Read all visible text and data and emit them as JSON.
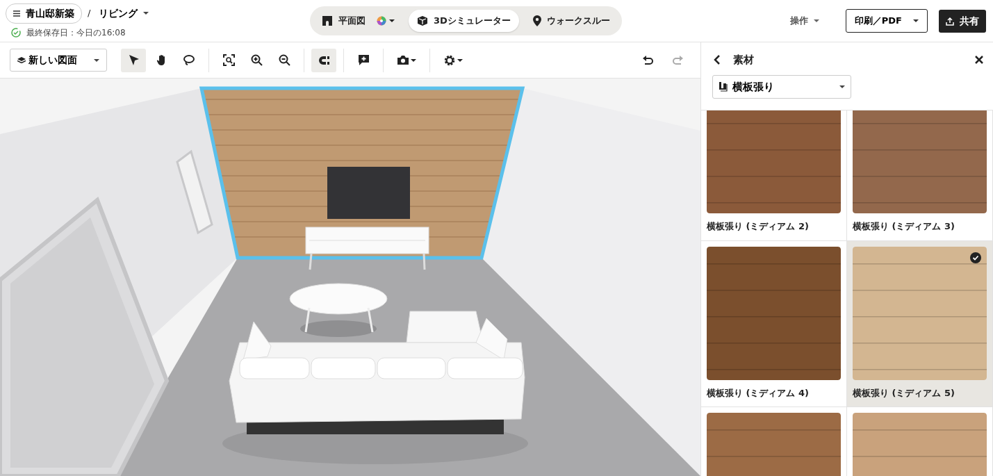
{
  "project": {
    "name": "青山邸新築",
    "separator": "/",
    "floor": "リビング",
    "save_status": "最終保存日：今日の16:08"
  },
  "view_tabs": [
    {
      "label": "平面図",
      "color_menu": true,
      "selected": false
    },
    {
      "label": "3Dシミュレーター",
      "color_menu": false,
      "selected": true
    },
    {
      "label": "ウォークスルー",
      "color_menu": false,
      "selected": false
    }
  ],
  "header_actions": {
    "operations": "操作",
    "print": "印刷／PDF",
    "share": "共有"
  },
  "toolbar": {
    "layer": "新しい図面",
    "groups": [
      [
        {
          "active": true,
          "dropdown": false
        },
        {
          "active": false,
          "dropdown": false
        },
        {
          "active": false,
          "dropdown": false
        }
      ],
      [
        {
          "active": false,
          "dropdown": false
        },
        {
          "active": false,
          "dropdown": false
        },
        {
          "active": false,
          "dropdown": false
        }
      ],
      [
        {
          "active": true,
          "dropdown": false
        }
      ],
      [
        {
          "active": false,
          "dropdown": false
        }
      ],
      [
        {
          "active": false,
          "dropdown": true
        }
      ],
      [
        {
          "active": false,
          "dropdown": true
        }
      ]
    ],
    "history": [
      {
        "disabled": false
      },
      {
        "disabled": true
      }
    ]
  },
  "panel": {
    "title": "素材",
    "category": "横板張り",
    "materials": [
      {
        "label": "横板張り (ミディアム 2)",
        "color": "#8b5a3a",
        "selected": false
      },
      {
        "label": "横板張り (ミディアム 3)",
        "color": "#93684c",
        "selected": false
      },
      {
        "label": "横板張り (ミディアム 4)",
        "color": "#7b4f2d",
        "selected": false
      },
      {
        "label": "横板張り (ミディアム 5)",
        "color": "#d3b691",
        "selected": true
      },
      {
        "color": "#9c6b45",
        "selected": false
      },
      {
        "color": "#c9a27c",
        "selected": false
      }
    ]
  }
}
